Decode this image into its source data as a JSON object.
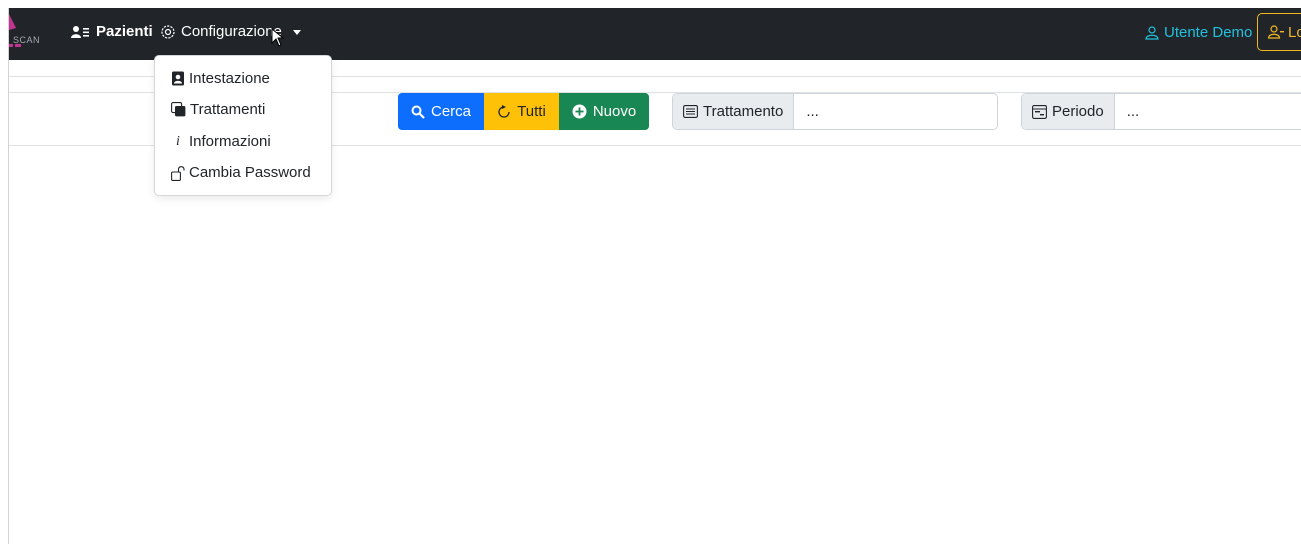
{
  "navbar": {
    "logo_text": "SCAN",
    "items": [
      {
        "label": "Pazienti",
        "icon": "users-icon"
      },
      {
        "label": "Configurazione",
        "icon": "gear-icon"
      }
    ],
    "user_label": "Utente Demo",
    "logout_label": "Lo"
  },
  "dropdown": {
    "items": [
      {
        "label": "Intestazione",
        "icon": "person-badge-icon"
      },
      {
        "label": "Trattamenti",
        "icon": "layers-icon"
      },
      {
        "label": "Informazioni",
        "icon": "info-icon"
      },
      {
        "label": "Cambia Password",
        "icon": "unlock-icon"
      }
    ]
  },
  "toolbar": {
    "search_label": "Cerca",
    "all_label": "Tutti",
    "new_label": "Nuovo",
    "treatment_label": "Trattamento",
    "treatment_value": "...",
    "period_label": "Periodo",
    "period_value": "..."
  },
  "colors": {
    "navbar_bg": "#212529",
    "primary": "#0d6efd",
    "warning": "#ffc107",
    "success": "#198754",
    "info": "#20c1df"
  }
}
